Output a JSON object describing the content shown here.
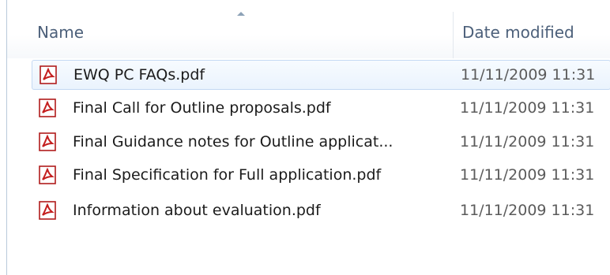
{
  "columns": {
    "name": "Name",
    "date_modified": "Date modified"
  },
  "files": [
    {
      "name": "EWQ PC FAQs.pdf",
      "date": "11/11/2009 11:31",
      "icon": "pdf-icon",
      "selected": true
    },
    {
      "name": "Final Call for Outline proposals.pdf",
      "date": "11/11/2009 11:31",
      "icon": "pdf-icon"
    },
    {
      "name": "Final Guidance notes for Outline applicat...",
      "date": "11/11/2009 11:31",
      "icon": "pdf-icon"
    },
    {
      "name": "Final Specification for Full application.pdf",
      "date": "11/11/2009 11:31",
      "icon": "pdf-icon"
    },
    {
      "name": "Information about evaluation.pdf",
      "date": "11/11/2009 11:31",
      "icon": "pdf-icon"
    }
  ],
  "colors": {
    "header_text": "#4c607a",
    "selection_border": "#c4d9f3",
    "pdf_red": "#c41e1e"
  }
}
